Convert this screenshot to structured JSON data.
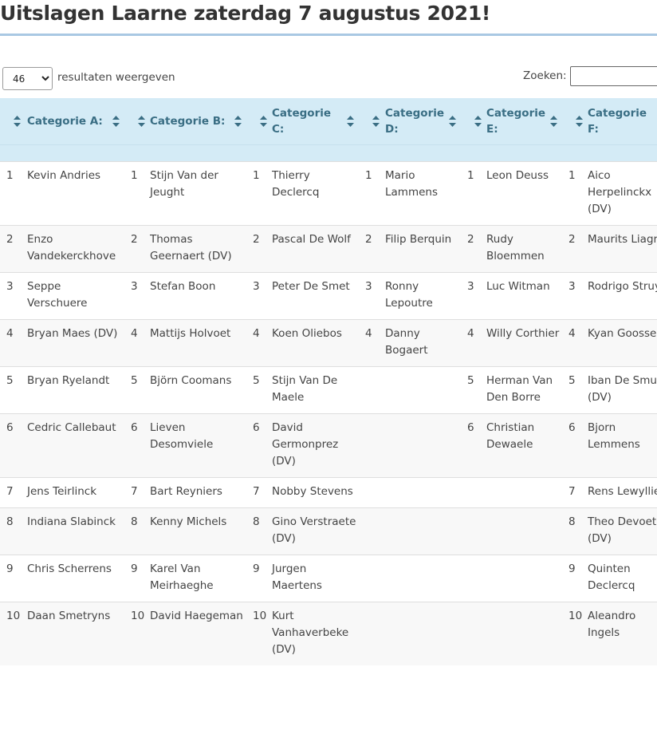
{
  "page": {
    "title": "Uitslagen Laarne zaterdag 7 augustus 2021!"
  },
  "controls": {
    "length_value": "46",
    "length_options": [
      "46"
    ],
    "length_label": "resultaten weergeven",
    "search_label": "Zoeken:",
    "search_value": ""
  },
  "table": {
    "headers": [
      "Categorie A:",
      "Categorie B:",
      "Categorie C:",
      "Categorie D:",
      "Categorie E:",
      "Categorie F:"
    ],
    "rows": [
      [
        [
          "1",
          "Kevin Andries"
        ],
        [
          "1",
          "Stijn Van der Jeught"
        ],
        [
          "1",
          "Thierry Declercq"
        ],
        [
          "1",
          "Mario Lammens"
        ],
        [
          "1",
          "Leon Deuss"
        ],
        [
          "1",
          "Aico Herpelinckx (DV)"
        ]
      ],
      [
        [
          "2",
          "Enzo Vandekerckhove"
        ],
        [
          "2",
          "Thomas Geernaert (DV)"
        ],
        [
          "2",
          "Pascal De Wolf"
        ],
        [
          "2",
          "Filip Berquin"
        ],
        [
          "2",
          "Rudy Bloemmen"
        ],
        [
          "2",
          "Maurits Liagre"
        ]
      ],
      [
        [
          "3",
          "Seppe Verschuere"
        ],
        [
          "3",
          "Stefan Boon"
        ],
        [
          "3",
          "Peter De Smet"
        ],
        [
          "3",
          "Ronny Lepoutre"
        ],
        [
          "3",
          "Luc Witman"
        ],
        [
          "3",
          "Rodrigo Struyf"
        ]
      ],
      [
        [
          "4",
          "Bryan Maes (DV)"
        ],
        [
          "4",
          "Mattijs Holvoet"
        ],
        [
          "4",
          "Koen Oliebos"
        ],
        [
          "4",
          "Danny Bogaert"
        ],
        [
          "4",
          "Willy Corthier"
        ],
        [
          "4",
          "Kyan Goossens"
        ]
      ],
      [
        [
          "5",
          "Bryan Ryelandt"
        ],
        [
          "5",
          "Björn Coomans"
        ],
        [
          "5",
          "Stijn Van De Maele"
        ],
        [
          "",
          ""
        ],
        [
          "5",
          "Herman Van Den Borre"
        ],
        [
          "5",
          "Iban De Smul (DV)"
        ]
      ],
      [
        [
          "6",
          "Cedric Callebaut"
        ],
        [
          "6",
          "Lieven Desomviele"
        ],
        [
          "6",
          "David Germonprez (DV)"
        ],
        [
          "",
          ""
        ],
        [
          "6",
          "Christian Dewaele"
        ],
        [
          "6",
          "Bjorn Lemmens"
        ]
      ],
      [
        [
          "7",
          "Jens Teirlinck"
        ],
        [
          "7",
          "Bart Reyniers"
        ],
        [
          "7",
          "Nobby Stevens"
        ],
        [
          "",
          ""
        ],
        [
          "",
          ""
        ],
        [
          "7",
          "Rens Lewyllie"
        ]
      ],
      [
        [
          "8",
          "Indiana Slabinck"
        ],
        [
          "8",
          "Kenny Michels"
        ],
        [
          "8",
          "Gino Verstraete (DV)"
        ],
        [
          "",
          ""
        ],
        [
          "",
          ""
        ],
        [
          "8",
          "Theo Devoet (DV)"
        ]
      ],
      [
        [
          "9",
          "Chris Scherrens"
        ],
        [
          "9",
          "Karel Van Meirhaeghe"
        ],
        [
          "9",
          "Jurgen Maertens"
        ],
        [
          "",
          ""
        ],
        [
          "",
          ""
        ],
        [
          "9",
          "Quinten Declercq"
        ]
      ],
      [
        [
          "10",
          "Daan Smetryns"
        ],
        [
          "10",
          "David Haegeman"
        ],
        [
          "10",
          "Kurt Vanhaverbeke (DV)"
        ],
        [
          "",
          ""
        ],
        [
          "",
          ""
        ],
        [
          "10",
          "Aleandro Ingels"
        ]
      ]
    ]
  }
}
